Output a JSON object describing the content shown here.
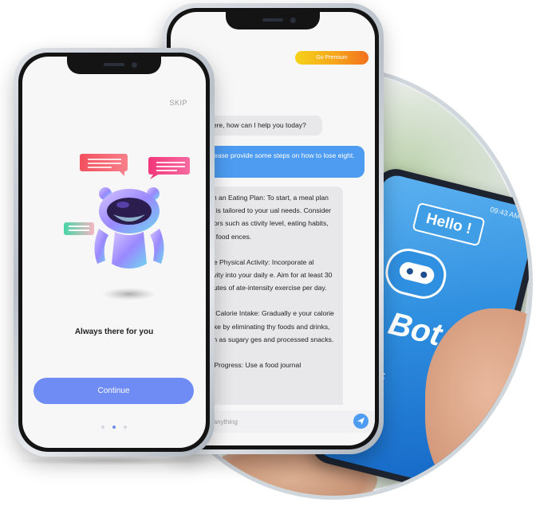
{
  "background": {
    "phone_status_time": "09:43 AM",
    "hello_text": "Hello !",
    "chatbot_text": "at Bot",
    "speak_text": "eak"
  },
  "chat_screen": {
    "premium_label": "Go Premium",
    "messages": [
      {
        "from": "bot",
        "text": "here, how can I help you today?"
      },
      {
        "from": "user",
        "text": "lease provide some steps on how to lose eight."
      },
      {
        "from": "bot",
        "paragraphs": [
          "blish an Eating Plan: To start, a meal plan that is tailored to your ual needs. Consider factors such as ctivity level, eating habits, and food ences.",
          "ease Physical Activity: Incorporate al activity into your daily e. Aim for at least 30 minutes of ate-intensity exercise per day.",
          "uce Calorie Intake: Gradually e your calorie intake by eliminating thy foods and drinks, such as sugary ges and processed snacks.",
          "itor Progress: Use a food journal"
        ]
      }
    ],
    "input_placeholder": "e anything"
  },
  "onboarding_screen": {
    "skip_label": "SKIP",
    "caption": "Always there for you",
    "continue_label": "Continue",
    "page_count": 3,
    "active_page": 2
  },
  "colors": {
    "accent": "#6f8cf5",
    "chat_blue": "#4d9cf2",
    "premium_start": "#f5d21a",
    "premium_end": "#f2701f"
  }
}
